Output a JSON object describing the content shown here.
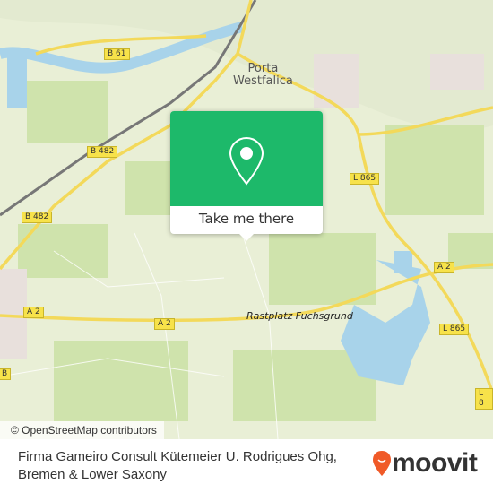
{
  "map": {
    "places": [
      "Porta",
      "Westfalica"
    ],
    "poi": "Rastplatz Fuchsgrund",
    "road_labels": [
      "B 61",
      "B 482",
      "B 482",
      "L 865",
      "L 865",
      "A 2",
      "A 2",
      "A 2",
      "L 8",
      "B"
    ],
    "attribution": "© OpenStreetMap contributors"
  },
  "popup": {
    "icon": "map-pin-icon",
    "button_label": "Take me there",
    "color": "#1db96a"
  },
  "footer": {
    "title_line1": "Firma Gameiro Consult Kütemeier U. Rodrigues Ohg,",
    "title_line2": "Bremen & Lower Saxony",
    "logo_text": "moovit",
    "logo_color": "#f05a28"
  }
}
